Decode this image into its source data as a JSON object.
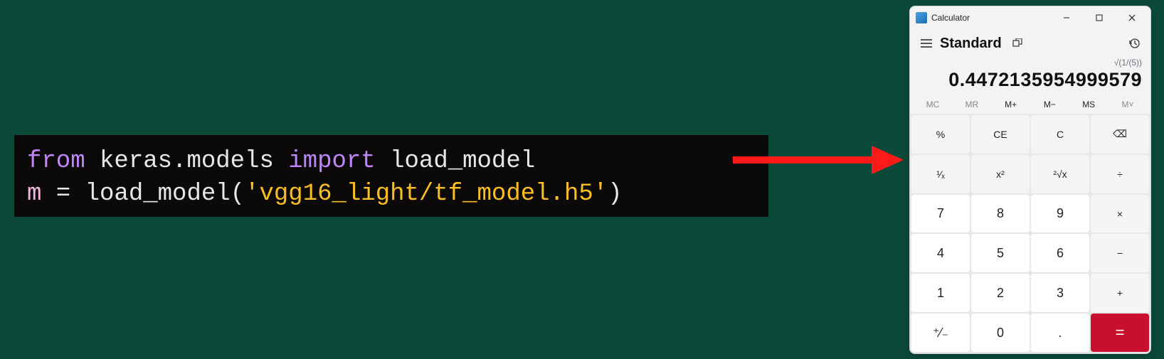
{
  "code": {
    "line1_kw1": "from",
    "line1_mod": " keras.models ",
    "line1_kw2": "import",
    "line1_name": " load_model",
    "line2_var": "m",
    "line2_eq": " = ",
    "line2_func": "load_model",
    "line2_lp": "(",
    "line2_str": "'vgg16_light/tf_model.h5'",
    "line2_rp": ")"
  },
  "calc": {
    "title": "Calculator",
    "mode": "Standard",
    "expression": "√(1/(5))",
    "result": "0.4472135954999579",
    "memory": {
      "mc": "MC",
      "mr": "MR",
      "mplus": "M+",
      "mminus": "M−",
      "ms": "MS",
      "mlist": "M˅"
    },
    "keys": {
      "percent": "%",
      "ce": "CE",
      "c": "C",
      "back": "⌫",
      "recip": "¹⁄ₓ",
      "sqr": "x²",
      "sqrt": "²√x",
      "div": "÷",
      "n7": "7",
      "n8": "8",
      "n9": "9",
      "mul": "×",
      "n4": "4",
      "n5": "5",
      "n6": "6",
      "sub": "−",
      "n1": "1",
      "n2": "2",
      "n3": "3",
      "add": "+",
      "neg": "⁺⁄₋",
      "n0": "0",
      "dot": ".",
      "eq": "="
    }
  }
}
